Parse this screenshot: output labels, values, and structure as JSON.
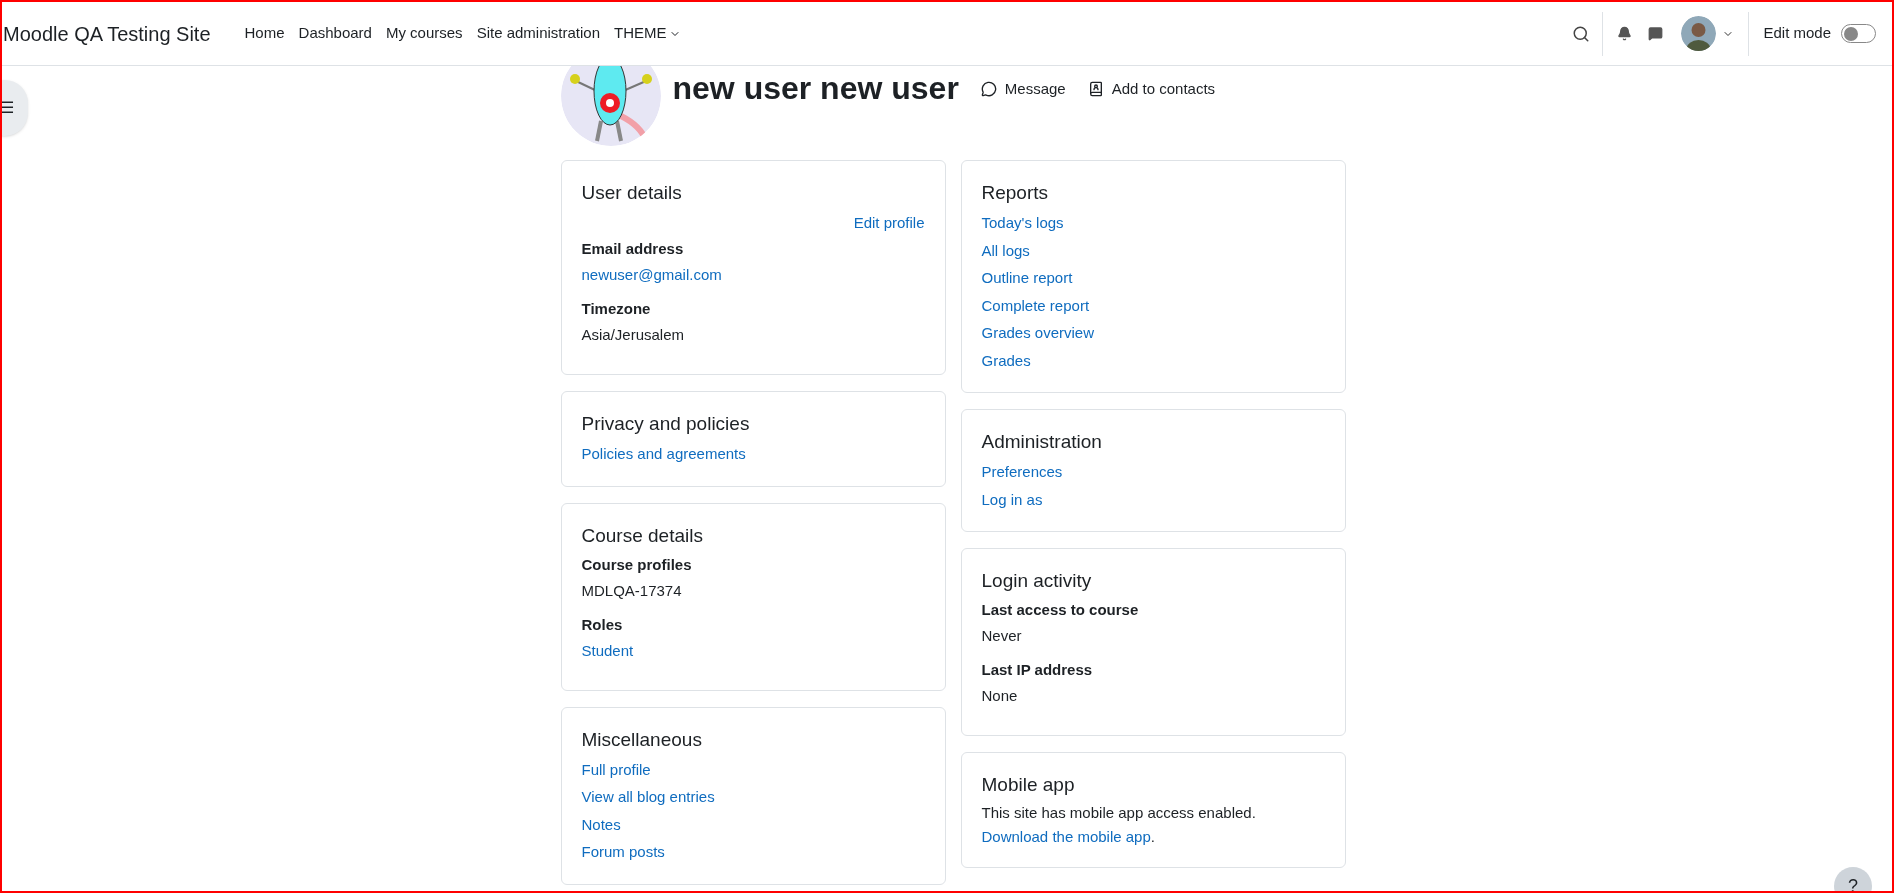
{
  "navbar": {
    "site_name": "Moodle QA Testing Site",
    "items": [
      {
        "label": "Home",
        "kind": "link"
      },
      {
        "label": "Dashboard",
        "kind": "link"
      },
      {
        "label": "My courses",
        "kind": "link"
      },
      {
        "label": "Site administration",
        "kind": "link"
      },
      {
        "label": "THEME",
        "kind": "dropdown"
      }
    ],
    "edit_mode": {
      "label": "Edit mode",
      "on": false
    }
  },
  "sidebar_toggle": {
    "icon": "☰"
  },
  "profile": {
    "name": "new user new user",
    "actions": [
      {
        "label": "Message",
        "kind": "message"
      },
      {
        "label": "Add to contacts",
        "kind": "contact"
      }
    ]
  },
  "left_column": [
    {
      "title": "User details",
      "items": [
        {
          "kind": "action",
          "text": "Edit profile"
        },
        {
          "kind": "field",
          "label": "Email address",
          "value": "newuser@gmail.com",
          "link": true
        },
        {
          "kind": "field",
          "label": "Timezone",
          "value": "Asia/Jerusalem",
          "link": false
        }
      ]
    },
    {
      "title": "Privacy and policies",
      "items": [
        {
          "kind": "link",
          "text": "Policies and agreements"
        }
      ]
    },
    {
      "title": "Course details",
      "items": [
        {
          "kind": "field",
          "label": "Course profiles",
          "value": "MDLQA-17374",
          "link": false
        },
        {
          "kind": "field",
          "label": "Roles",
          "value": "Student",
          "link": true
        }
      ]
    },
    {
      "title": "Miscellaneous",
      "items": [
        {
          "kind": "link",
          "text": "Full profile"
        },
        {
          "kind": "link",
          "text": "View all blog entries"
        },
        {
          "kind": "link",
          "text": "Notes"
        },
        {
          "kind": "link",
          "text": "Forum posts"
        }
      ]
    }
  ],
  "right_column": [
    {
      "title": "Reports",
      "items": [
        {
          "kind": "link",
          "text": "Today's logs"
        },
        {
          "kind": "link",
          "text": "All logs"
        },
        {
          "kind": "link",
          "text": "Outline report"
        },
        {
          "kind": "link",
          "text": "Complete report"
        },
        {
          "kind": "link",
          "text": "Grades overview"
        },
        {
          "kind": "link",
          "text": "Grades"
        }
      ]
    },
    {
      "title": "Administration",
      "items": [
        {
          "kind": "link",
          "text": "Preferences"
        },
        {
          "kind": "link",
          "text": "Log in as"
        }
      ]
    },
    {
      "title": "Login activity",
      "items": [
        {
          "kind": "field",
          "label": "Last access to course",
          "value": "Never",
          "link": false
        },
        {
          "kind": "field",
          "label": "Last IP address",
          "value": "None",
          "link": false
        }
      ]
    },
    {
      "title": "Mobile app",
      "items": [
        {
          "kind": "text",
          "text": "This site has mobile app access enabled."
        },
        {
          "kind": "link_sentence",
          "text": "Download the mobile app",
          "suffix": "."
        }
      ]
    }
  ],
  "help_button": {
    "label": "?"
  }
}
